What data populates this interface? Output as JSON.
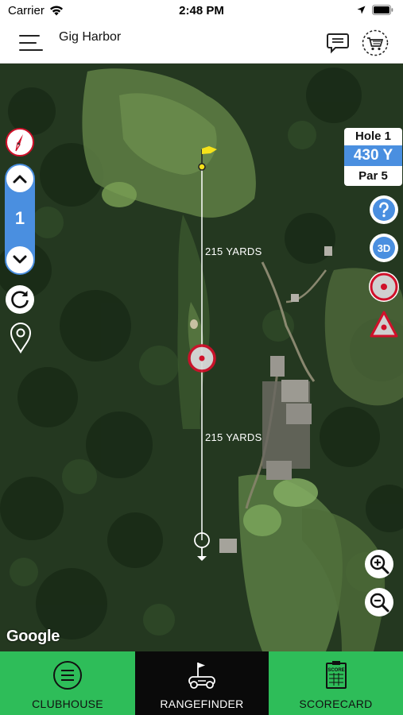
{
  "status_bar": {
    "carrier": "Carrier",
    "time": "2:48 PM"
  },
  "header": {
    "title": "Gig Harbor",
    "icons": [
      "menu-icon",
      "chat-icon",
      "pro-shop-cart-icon"
    ]
  },
  "hole_picker": {
    "current_hole": "1"
  },
  "hole_info": {
    "hole": "Hole 1",
    "yardage": "430 Y",
    "par": "Par 5"
  },
  "distances": {
    "upper_segment": "215 YARDS",
    "lower_segment": "215 YARDS"
  },
  "map": {
    "attribution": "Google"
  },
  "tabs": [
    {
      "label": "CLUBHOUSE",
      "icon": "list-circle-icon",
      "active": false
    },
    {
      "label": "RANGEFINDER",
      "icon": "flag-cart-icon",
      "active": true
    },
    {
      "label": "SCORECARD",
      "icon": "scorecard-icon",
      "active": false
    }
  ],
  "colors": {
    "accent_blue": "#4a8fe0",
    "tab_green": "#2ebd59",
    "tab_active_bg": "#0a0a0a",
    "target_red": "#d0102a",
    "flag_yellow": "#f5e21a"
  }
}
